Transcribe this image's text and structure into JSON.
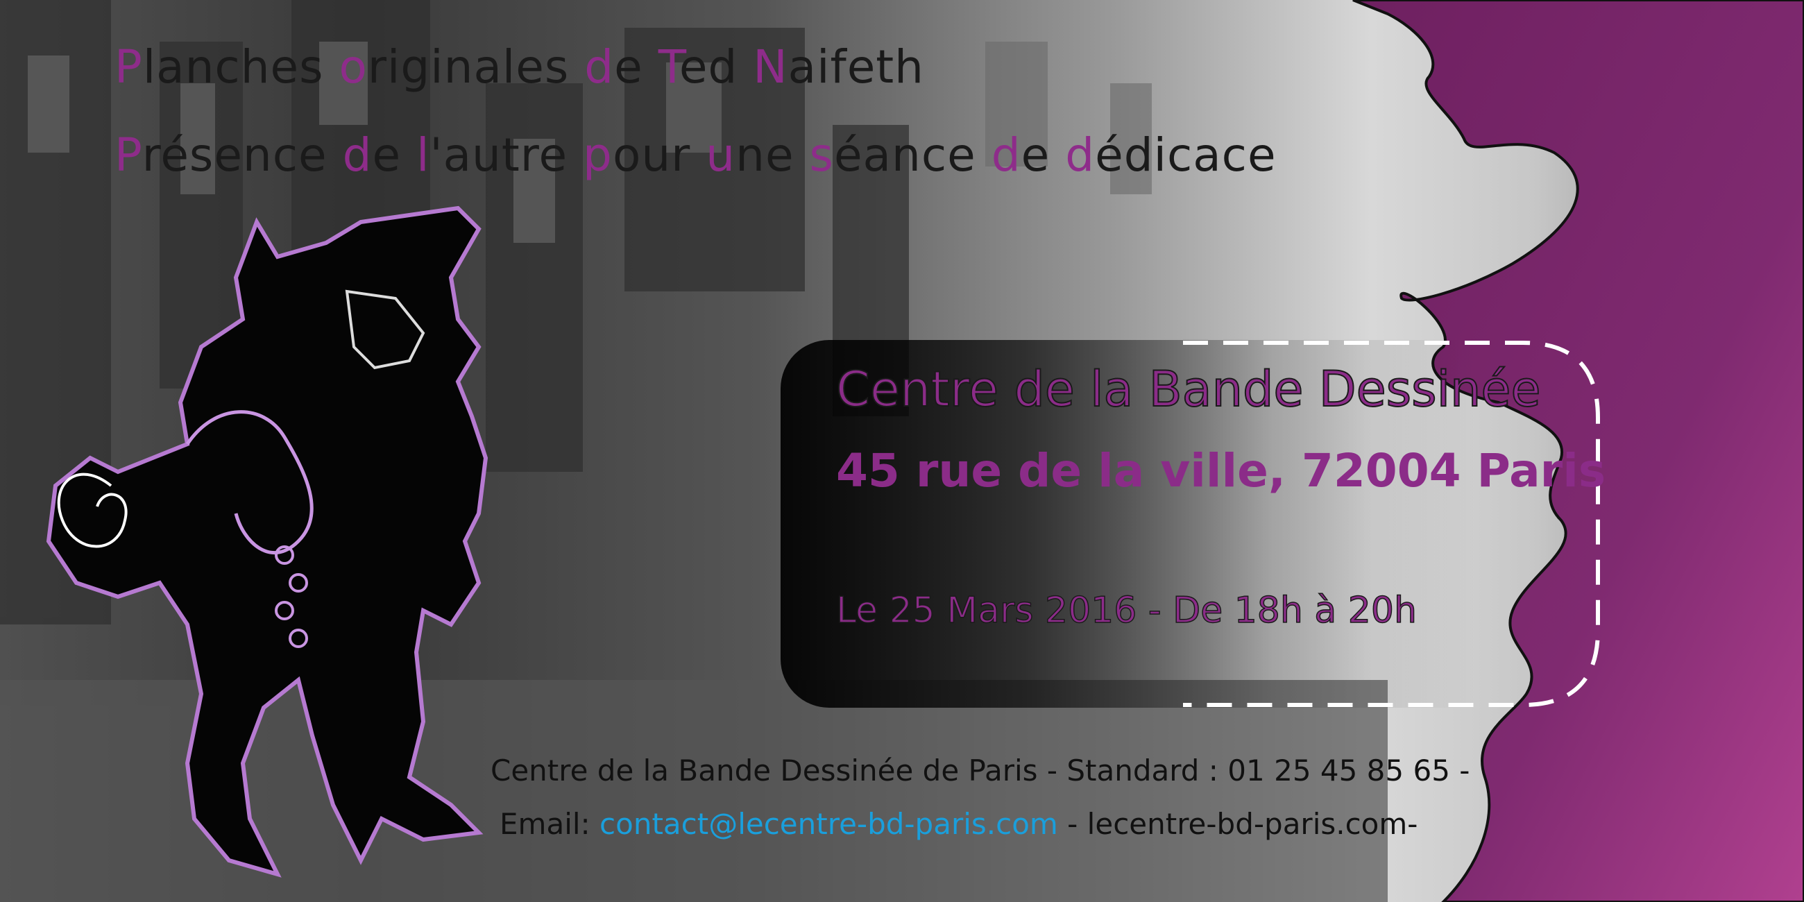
{
  "heading": {
    "line1": [
      {
        "text": "P",
        "hl": true
      },
      {
        "text": "lanches ",
        "hl": false
      },
      {
        "text": "o",
        "hl": true
      },
      {
        "text": "riginales ",
        "hl": false
      },
      {
        "text": "d",
        "hl": true
      },
      {
        "text": "e ",
        "hl": false
      },
      {
        "text": "T",
        "hl": true
      },
      {
        "text": "ed ",
        "hl": false
      },
      {
        "text": "N",
        "hl": true
      },
      {
        "text": "aifeth",
        "hl": false
      }
    ],
    "line2": [
      {
        "text": "P",
        "hl": true
      },
      {
        "text": "résence ",
        "hl": false
      },
      {
        "text": "d",
        "hl": true
      },
      {
        "text": "e ",
        "hl": false
      },
      {
        "text": "l",
        "hl": true
      },
      {
        "text": "'autre ",
        "hl": false
      },
      {
        "text": "p",
        "hl": true
      },
      {
        "text": "our ",
        "hl": false
      },
      {
        "text": "u",
        "hl": true
      },
      {
        "text": "ne ",
        "hl": false
      },
      {
        "text": "s",
        "hl": true
      },
      {
        "text": "éance ",
        "hl": false
      },
      {
        "text": "d",
        "hl": true
      },
      {
        "text": "e ",
        "hl": false
      },
      {
        "text": "d",
        "hl": true
      },
      {
        "text": "édicace",
        "hl": false
      }
    ]
  },
  "event": {
    "venue": "Centre de la Bande Dessinée",
    "address": "45 rue de la ville, 72004 Paris",
    "date": "Le 25 Mars 2016 - De 18h à 20h"
  },
  "footer": {
    "line1": "Centre de la Bande Dessinée de Paris - Standard : 01 25 45 85 65 -",
    "email_label": "Email: ",
    "email": "contact@lecentre-bd-paris.com",
    "website": " - lecentre-bd-paris.com-"
  },
  "colors": {
    "accent": "#8b2c88",
    "magenta_bg": "#7a2a6a",
    "link": "#1a9fdc"
  }
}
